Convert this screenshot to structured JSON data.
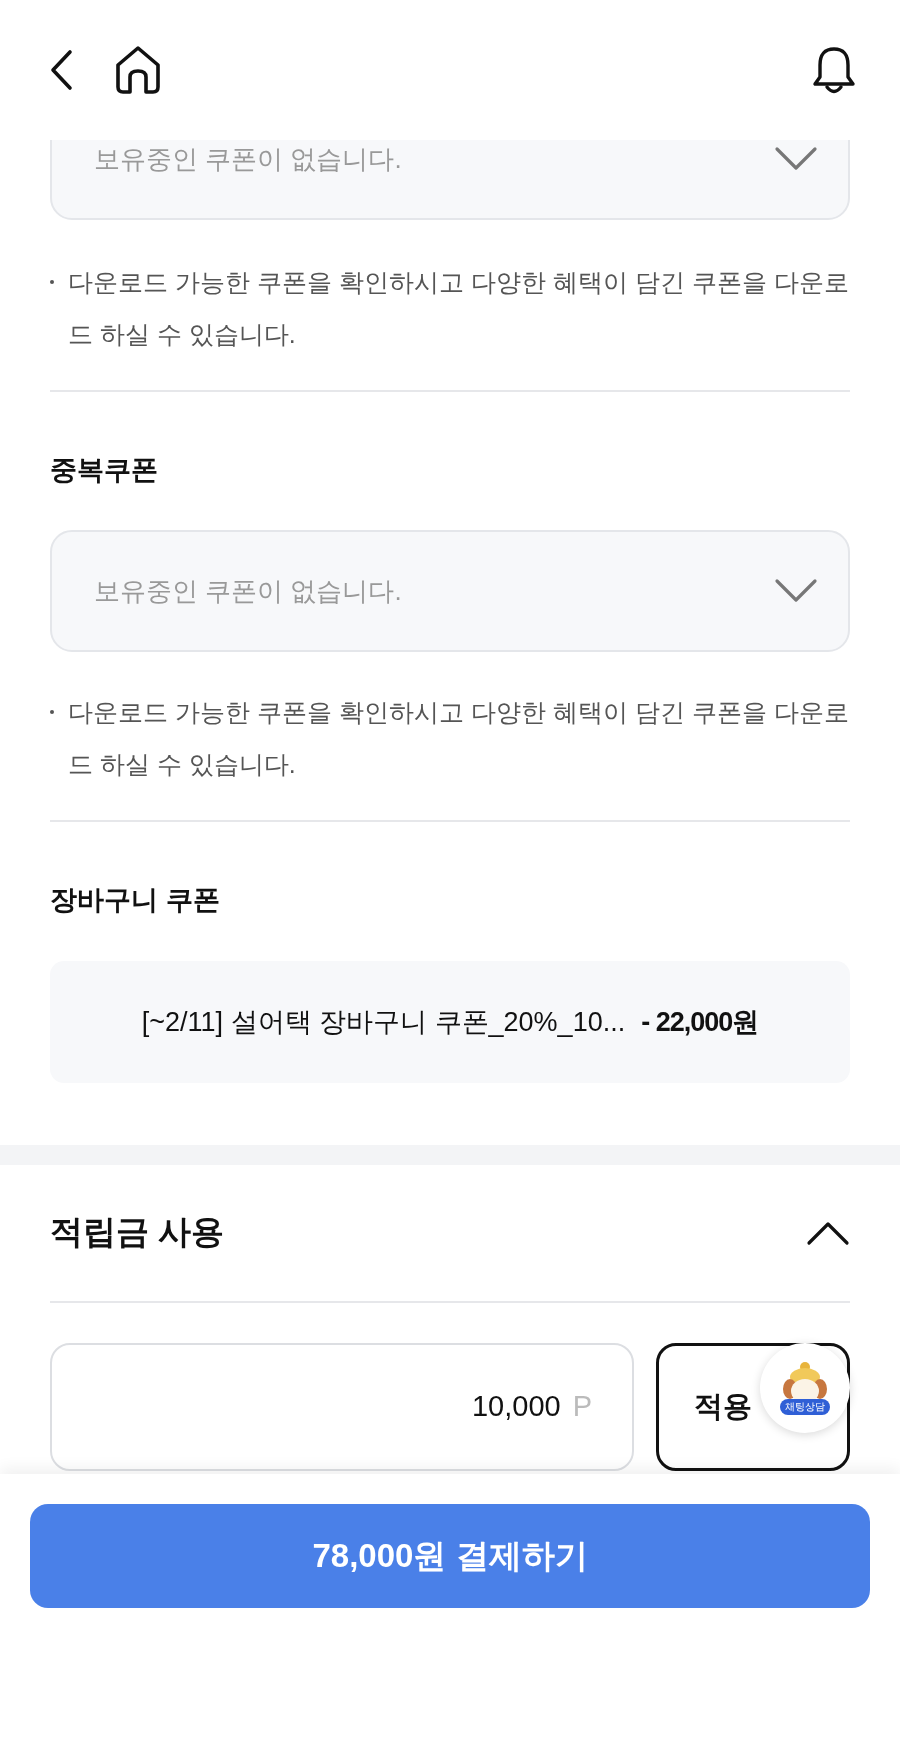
{
  "coupon_sections": [
    {
      "dropdown": {
        "value": "보유중인 쿠폰이 없습니다."
      },
      "note": "다운로드 가능한 쿠폰을 확인하시고 다양한 혜택이 담긴 쿠폰을 다운로드 하실 수 있습니다."
    },
    {
      "heading": "중복쿠폰",
      "dropdown": {
        "value": "보유중인 쿠폰이 없습니다."
      },
      "note": "다운로드 가능한 쿠폰을 확인하시고 다양한 혜택이 담긴 쿠폰을 다운로드 하실 수 있습니다."
    }
  ],
  "cart_coupon": {
    "heading": "장바구니 쿠폰",
    "name": "[~2/11] 설어택 장바구니 쿠폰_20%_10...",
    "discount": "- 22,000원"
  },
  "points": {
    "heading": "적립금 사용",
    "expanded": true,
    "value": "10,000",
    "unit": "P",
    "apply_label": "적용"
  },
  "chat_widget": {
    "badge": "채팅상담"
  },
  "pay_button": "78,000원 결제하기"
}
